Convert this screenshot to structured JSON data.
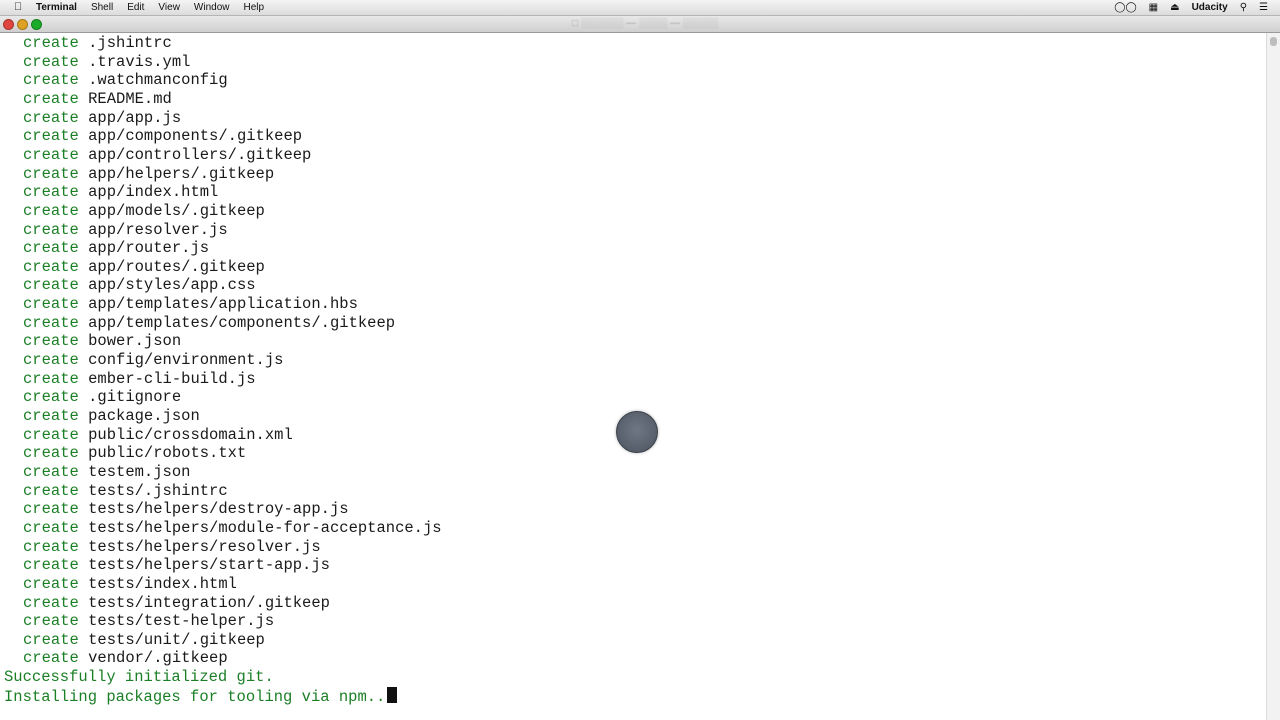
{
  "menubar": {
    "apple_icon": "apple-logo",
    "items": [
      "Terminal",
      "Shell",
      "Edit",
      "View",
      "Window",
      "Help"
    ],
    "right": {
      "user": "Udacity"
    }
  },
  "terminal": {
    "verb": "create",
    "created_files": [
      ".jshintrc",
      ".travis.yml",
      ".watchmanconfig",
      "README.md",
      "app/app.js",
      "app/components/.gitkeep",
      "app/controllers/.gitkeep",
      "app/helpers/.gitkeep",
      "app/index.html",
      "app/models/.gitkeep",
      "app/resolver.js",
      "app/router.js",
      "app/routes/.gitkeep",
      "app/styles/app.css",
      "app/templates/application.hbs",
      "app/templates/components/.gitkeep",
      "bower.json",
      "config/environment.js",
      "ember-cli-build.js",
      ".gitignore",
      "package.json",
      "public/crossdomain.xml",
      "public/robots.txt",
      "testem.json",
      "tests/.jshintrc",
      "tests/helpers/destroy-app.js",
      "tests/helpers/module-for-acceptance.js",
      "tests/helpers/resolver.js",
      "tests/helpers/start-app.js",
      "tests/index.html",
      "tests/integration/.gitkeep",
      "tests/test-helper.js",
      "tests/unit/.gitkeep",
      "vendor/.gitkeep"
    ],
    "status_line": "Successfully initialized git.",
    "progress_line": "Installing packages for tooling via npm.."
  },
  "colors": {
    "green": "#1b7f26",
    "text": "#1a1a1a"
  }
}
